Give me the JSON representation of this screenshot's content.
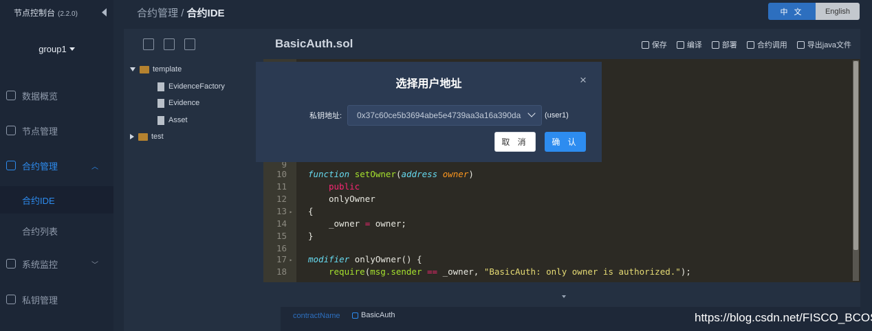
{
  "app": {
    "title": "节点控制台",
    "version": "(2.2.0)"
  },
  "sidebar": {
    "group": "group1",
    "items": [
      {
        "label": "数据概览",
        "icon": "home-icon"
      },
      {
        "label": "节点管理",
        "icon": "calendar-icon"
      },
      {
        "label": "合约管理",
        "icon": "clipboard-icon",
        "active": true,
        "expanded": true
      },
      {
        "label": "系统监控",
        "icon": "monitor-icon"
      },
      {
        "label": "私钥管理",
        "icon": "lock-icon"
      }
    ],
    "subitems": [
      {
        "label": "合约IDE",
        "active": true
      },
      {
        "label": "合约列表"
      }
    ]
  },
  "breadcrumb": {
    "parent": "合约管理",
    "separator": "/",
    "current": "合约IDE"
  },
  "language": {
    "zh": "中 文",
    "en": "English",
    "active": "zh"
  },
  "file_tree": {
    "folders": [
      {
        "name": "template",
        "expanded": true,
        "files": [
          "EvidenceFactory",
          "Evidence",
          "Asset"
        ]
      },
      {
        "name": "test",
        "expanded": false,
        "files": []
      }
    ]
  },
  "editor": {
    "file_name": "BasicAuth.sol",
    "actions": [
      "保存",
      "编译",
      "部署",
      "合约调用",
      "导出java文件"
    ],
    "lines": [
      {
        "n": "9",
        "text": ""
      },
      {
        "n": "10",
        "text": "function setOwner(address owner)"
      },
      {
        "n": "11",
        "text": "public"
      },
      {
        "n": "12",
        "text": "onlyOwner"
      },
      {
        "n": "13",
        "text": "{"
      },
      {
        "n": "14",
        "text": "_owner = owner;"
      },
      {
        "n": "15",
        "text": "}"
      },
      {
        "n": "16",
        "text": ""
      },
      {
        "n": "17",
        "text": "modifier onlyOwner() {"
      },
      {
        "n": "18",
        "text": "require(msg.sender == _owner, \"BasicAuth: only owner is authorized.\");"
      }
    ],
    "tokens": {
      "l10": [
        "function",
        "setOwner",
        "(",
        "address",
        "owner",
        ")"
      ],
      "l14": [
        "_owner",
        "=",
        "owner;"
      ],
      "l17": [
        "modifier",
        "onlyOwner() {"
      ],
      "l18": [
        "require",
        "(",
        "msg.sender",
        "==",
        "_owner,",
        "\"BasicAuth: only owner is authorized.\"",
        ");"
      ]
    }
  },
  "result": {
    "label": "contractName",
    "value": "BasicAuth"
  },
  "watermark": "https://blog.csdn.net/FISCO_BCOS",
  "modal": {
    "title": "选择用户地址",
    "field_label": "私钥地址:",
    "selected_address": "0x37c60ce5b3694abe5e4739aa3a16a390da",
    "user_tag": "(user1)",
    "cancel": "取 消",
    "confirm": "确 认"
  },
  "colors": {
    "accent": "#2d8cf0",
    "folder": "#b5822f",
    "modal_bg": "#2b3a52"
  }
}
